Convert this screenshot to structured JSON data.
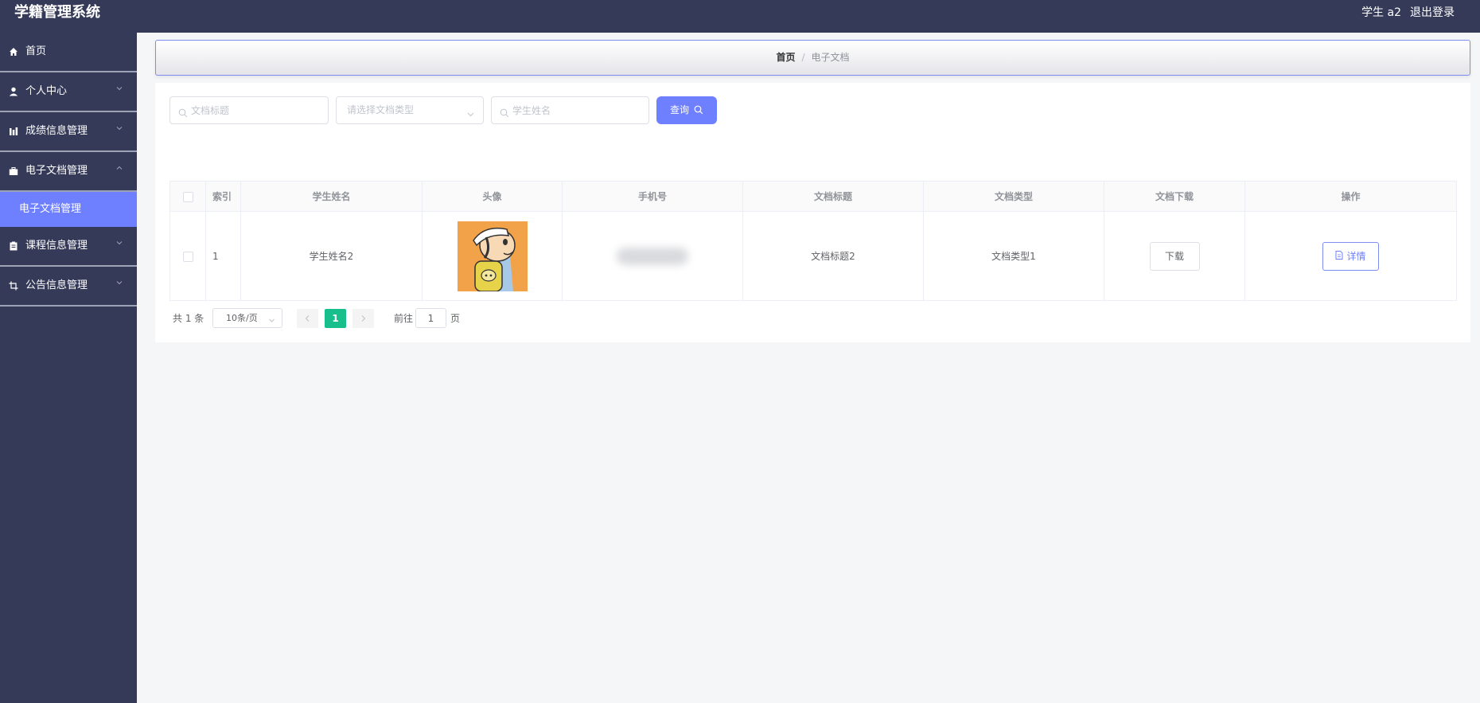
{
  "header": {
    "app_title": "学籍管理系统",
    "user_label": "学生 a2",
    "logout_label": "退出登录"
  },
  "sidebar": {
    "items": [
      {
        "label": "首页",
        "icon": "home-icon",
        "expandable": false
      },
      {
        "label": "个人中心",
        "icon": "user-icon",
        "expandable": true,
        "expanded": false
      },
      {
        "label": "成绩信息管理",
        "icon": "chart-bar-icon",
        "expandable": true,
        "expanded": false
      },
      {
        "label": "电子文档管理",
        "icon": "briefcase-icon",
        "expandable": true,
        "expanded": true,
        "children": [
          {
            "label": "电子文档管理",
            "active": true
          }
        ]
      },
      {
        "label": "课程信息管理",
        "icon": "clipboard-icon",
        "expandable": true,
        "expanded": false
      },
      {
        "label": "公告信息管理",
        "icon": "crop-icon",
        "expandable": true,
        "expanded": false
      }
    ]
  },
  "breadcrumb": {
    "home": "首页",
    "separator": "/",
    "current": "电子文档"
  },
  "search": {
    "title_placeholder": "文档标题",
    "type_placeholder": "请选择文档类型",
    "name_placeholder": "学生姓名",
    "query_label": "查询"
  },
  "table": {
    "headers": [
      "索引",
      "学生姓名",
      "头像",
      "手机号",
      "文档标题",
      "文档类型",
      "文档下载",
      "操作"
    ],
    "rows": [
      {
        "index": "1",
        "student_name": "学生姓名2",
        "avatar": "cartoon-boy-avatar",
        "phone": "",
        "doc_title": "文档标题2",
        "doc_type": "文档类型1",
        "download_label": "下载",
        "detail_label": "详情"
      }
    ]
  },
  "pagination": {
    "total_text": "共 1 条",
    "page_size": "10条/页",
    "current_page": "1",
    "goto_label": "前往",
    "goto_value": "1",
    "page_suffix": "页"
  },
  "colors": {
    "topbar_bg": "#353a58",
    "sidebar_bg": "#353a58",
    "accent": "#6e7fff",
    "pager_active": "#17bf8c",
    "page_bg": "#f5f6f8"
  }
}
